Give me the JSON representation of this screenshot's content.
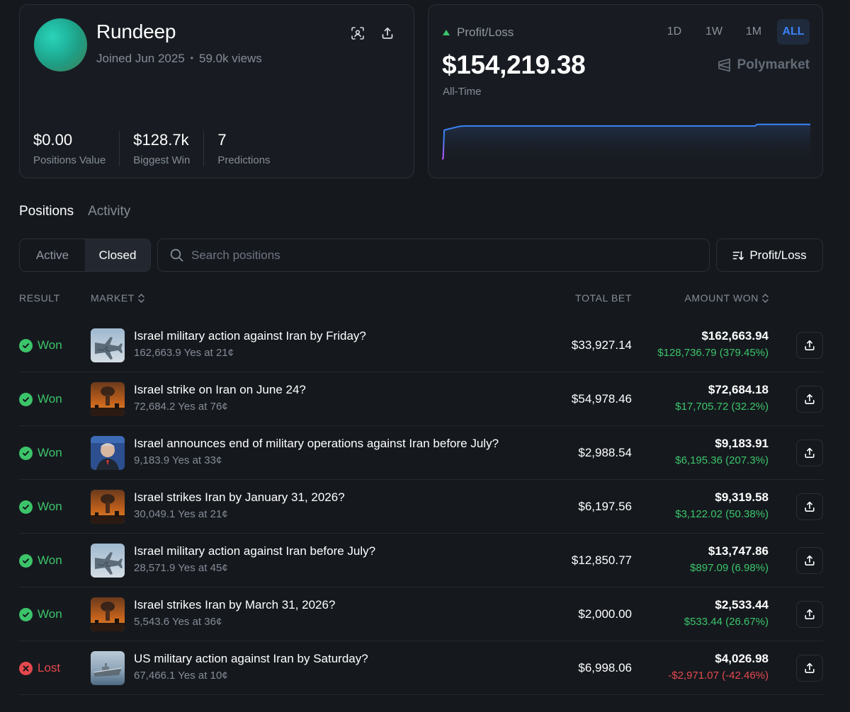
{
  "profile": {
    "username": "Rundeep",
    "joined": "Joined Jun 2025",
    "views": "59.0k views",
    "stats": [
      {
        "value": "$0.00",
        "label": "Positions Value"
      },
      {
        "value": "$128.7k",
        "label": "Biggest Win"
      },
      {
        "value": "7",
        "label": "Predictions"
      }
    ],
    "icons": [
      "scan-icon",
      "share-icon"
    ],
    "avatar_gradient": [
      "#2ad3b8",
      "#56a37a"
    ]
  },
  "pnl": {
    "label": "Profit/Loss",
    "value": "$154,219.38",
    "period": "All-Time",
    "brand": "Polymarket",
    "ranges": [
      "1D",
      "1W",
      "1M",
      "ALL"
    ],
    "active_range": "ALL",
    "accent_color": "#3b82f6",
    "up_color": "#3cc46a"
  },
  "chart_data": {
    "type": "line",
    "title": "",
    "xlabel": "",
    "ylabel": "",
    "grid": false,
    "legend": "none",
    "x": [
      0,
      0.3,
      0.6,
      1.2,
      4.8,
      6,
      85,
      85.5,
      100
    ],
    "values": [
      0,
      2.3,
      73,
      75,
      83,
      84,
      84,
      88,
      88
    ],
    "ylim": [
      0,
      100
    ],
    "color_start": "#c050ff",
    "color": "#3b82f6"
  },
  "tabs": {
    "positions": "Positions",
    "activity": "Activity",
    "active": "positions"
  },
  "filters": {
    "active": "Active",
    "closed": "Closed",
    "selected": "closed",
    "search_placeholder": "Search positions",
    "sort": "Profit/Loss"
  },
  "table": {
    "headers": {
      "result": "RESULT",
      "market": "MARKET",
      "total_bet": "TOTAL BET",
      "amount_won": "AMOUNT WON"
    },
    "rows": [
      {
        "result": "Won",
        "status": "won",
        "thumb": "jet",
        "title": "Israel military action against Iran by Friday?",
        "shares": "162,663.9 Yes at 21¢",
        "total_bet": "$33,927.14",
        "amount": "$162,663.94",
        "pnl": "$128,736.79 (379.45%)",
        "pnl_sign": "pos"
      },
      {
        "result": "Won",
        "status": "won",
        "thumb": "explosion",
        "title": "Israel strike on Iran on June 24?",
        "shares": "72,684.2 Yes at 76¢",
        "total_bet": "$54,978.46",
        "amount": "$72,684.18",
        "pnl": "$17,705.72 (32.2%)",
        "pnl_sign": "pos"
      },
      {
        "result": "Won",
        "status": "won",
        "thumb": "portrait",
        "title": "Israel announces end of military operations against Iran before July?",
        "shares": "9,183.9 Yes at 33¢",
        "total_bet": "$2,988.54",
        "amount": "$9,183.91",
        "pnl": "$6,195.36 (207.3%)",
        "pnl_sign": "pos"
      },
      {
        "result": "Won",
        "status": "won",
        "thumb": "explosion",
        "title": "Israel strikes Iran by January 31, 2026?",
        "shares": "30,049.1 Yes at 21¢",
        "total_bet": "$6,197.56",
        "amount": "$9,319.58",
        "pnl": "$3,122.02 (50.38%)",
        "pnl_sign": "pos"
      },
      {
        "result": "Won",
        "status": "won",
        "thumb": "jet",
        "title": "Israel military action against Iran before July?",
        "shares": "28,571.9 Yes at 45¢",
        "total_bet": "$12,850.77",
        "amount": "$13,747.86",
        "pnl": "$897.09 (6.98%)",
        "pnl_sign": "pos"
      },
      {
        "result": "Won",
        "status": "won",
        "thumb": "explosion",
        "title": "Israel strikes Iran by March 31, 2026?",
        "shares": "5,543.6 Yes at 36¢",
        "total_bet": "$2,000.00",
        "amount": "$2,533.44",
        "pnl": "$533.44 (26.67%)",
        "pnl_sign": "pos"
      },
      {
        "result": "Lost",
        "status": "lost",
        "thumb": "ship",
        "title": "US military action against Iran by Saturday?",
        "shares": "67,466.1 Yes at 10¢",
        "total_bet": "$6,998.06",
        "amount": "$4,026.98",
        "pnl": "-$2,971.07 (-42.46%)",
        "pnl_sign": "neg"
      }
    ]
  }
}
